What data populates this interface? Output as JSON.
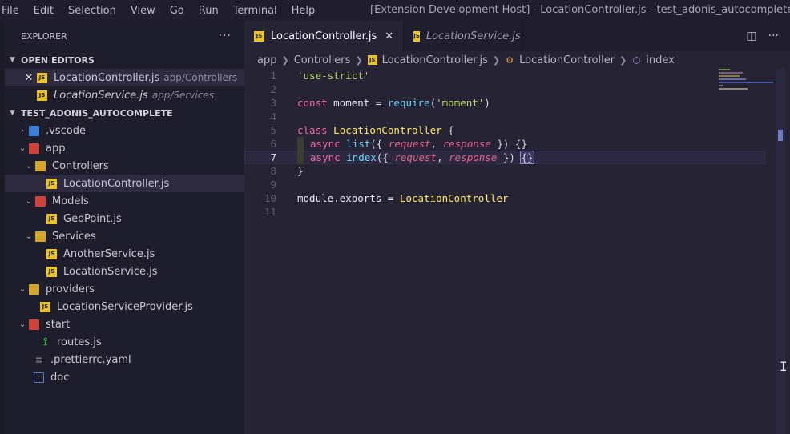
{
  "menubar": {
    "items": [
      "File",
      "Edit",
      "Selection",
      "View",
      "Go",
      "Run",
      "Terminal",
      "Help"
    ],
    "title": "[Extension Development Host] - LocationController.js - test_adonis_autocomplete - Visual Studio Code"
  },
  "sidebar": {
    "header": "EXPLORER",
    "more_icon": "more-actions-icon",
    "open_editors_label": "OPEN EDITORS",
    "open_editors": [
      {
        "name": "LocationController.js",
        "path": "app/Controllers"
      },
      {
        "name": "LocationService.js",
        "path": "app/Services"
      }
    ],
    "project_label": "TEST_ADONIS_AUTOCOMPLETE",
    "tree": [
      {
        "name": ".vscode"
      },
      {
        "name": "app"
      },
      {
        "name": "Controllers"
      },
      {
        "name": "LocationController.js"
      },
      {
        "name": "Models"
      },
      {
        "name": "GeoPoint.js"
      },
      {
        "name": "Services"
      },
      {
        "name": "AnotherService.js"
      },
      {
        "name": "LocationService.js"
      },
      {
        "name": "providers"
      },
      {
        "name": "LocationServiceProvider.js"
      },
      {
        "name": "start"
      },
      {
        "name": "routes.js"
      },
      {
        "name": ".prettierrc.yaml"
      },
      {
        "name": "doc"
      }
    ]
  },
  "tabs": [
    {
      "label": "LocationController.js"
    },
    {
      "label": "LocationService.js"
    }
  ],
  "breadcrumb": {
    "parts": [
      "app",
      "Controllers",
      "LocationController.js",
      "LocationController",
      "index"
    ]
  },
  "code": {
    "line_numbers": [
      "1",
      "2",
      "3",
      "4",
      "5",
      "6",
      "7",
      "8",
      "9",
      "10",
      "11"
    ],
    "l1": "'use-strict'",
    "l3_kw": "const",
    "l3_a": " moment = ",
    "l3_fn": "require",
    "l3_b": "(",
    "l3_str": "'moment'",
    "l3_c": ")",
    "l5_kw": "class",
    "l5_cls": " LocationController",
    "l5_b": " {",
    "l6_kw": "async",
    "l6_fn": " list",
    "l6_a": "({ ",
    "l6_p1": "request",
    "l6_sep": ", ",
    "l6_p2": "response",
    "l6_b": " }) {}",
    "l7_kw": "async",
    "l7_fn": " index",
    "l7_a": "({ ",
    "l7_p1": "request",
    "l7_sep": ", ",
    "l7_p2": "response",
    "l7_b": " }) ",
    "l7_br": "{}",
    "l8": "}",
    "l10_a": "module.exports = ",
    "l10_cls": "LocationController"
  },
  "colors": {
    "background": "#262335",
    "sidebar": "#1e1d2c",
    "keyword": "#f467a8",
    "class": "#ffe766",
    "function": "#6cd4f5",
    "string": "#b5d66a",
    "param": "#e2608a"
  }
}
